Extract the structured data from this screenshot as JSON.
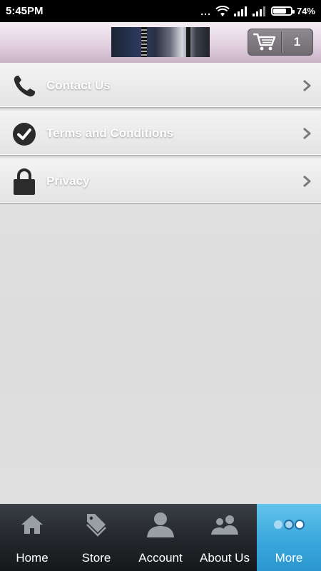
{
  "status_bar": {
    "time": "5:45PM",
    "dots": "...",
    "battery_percent": "74%",
    "battery_level": 0.74
  },
  "header": {
    "cart_count": "1"
  },
  "menu": {
    "items": [
      {
        "label": "Contact Us",
        "icon": "phone-icon"
      },
      {
        "label": "Terms and Conditions",
        "icon": "check-circle-icon"
      },
      {
        "label": "Privacy",
        "icon": "lock-icon"
      }
    ]
  },
  "tabs": [
    {
      "label": "Home",
      "icon": "home-icon"
    },
    {
      "label": "Store",
      "icon": "tags-icon"
    },
    {
      "label": "Account",
      "icon": "user-icon"
    },
    {
      "label": "About Us",
      "icon": "users-icon"
    },
    {
      "label": "More",
      "icon": "more-dots-icon",
      "active": true
    }
  ],
  "colors": {
    "active_tab": "#3aa8dc",
    "header_tint": "#e2d1e0",
    "tab_bar": "#24282c"
  }
}
